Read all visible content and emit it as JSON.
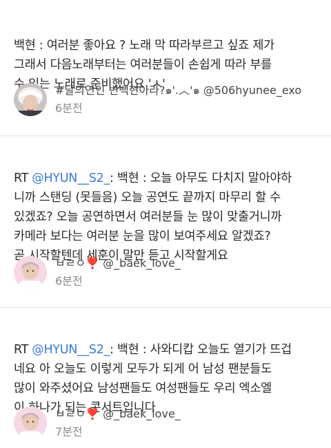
{
  "tweets": [
    {
      "prefix": "",
      "mention": "",
      "body": "백현 : 여러분 좋아요 ? 노래 막 따라부르고 싶죠 제가\n그래서 다음노래부터는 여러분들이 손쉽게 따라 부를\n수 있는 노래로 준비했어요 'ㅅ'",
      "author": "#달의연인 변백현아라?๑'.︿'๑ @506hyunee_exo",
      "time": "6분전"
    },
    {
      "prefix": "RT ",
      "mention": "@HYUN__S2_",
      "body": ": 백현 : 오늘 아무도 다치지 말아야하\n니까 스탠딩 (못들음) 오늘 공연도 끝까지 마무리 할 수\n있겠죠? 오늘 공연하면서 여러분들 눈 많이 맞출거니까\n카메라 보다는 여러분 눈을 많이 보여주세요 알겠죠?\n곧 시작할텐데 세훈이 말만 듣고 시작할게요",
      "author": "ㅂㄹㅇ❣️ @_baek_love_",
      "time": "6분전"
    },
    {
      "prefix": "RT ",
      "mention": "@HYUN__S2_",
      "body": ": 백현 : 사와디캅 오늘도 열기가 뜨겁\n네요 아 오늘도 이렇게 모두가 되게 어 남성 팬분들도\n많이 와주셨어요 남성팬들도 여성팬들도 우리 엑소엘\n이 하나가 되는 콘서트입니다",
      "author": "ㅂㄹㅇ❣️ @_baek_love_",
      "time": "7분전"
    }
  ]
}
